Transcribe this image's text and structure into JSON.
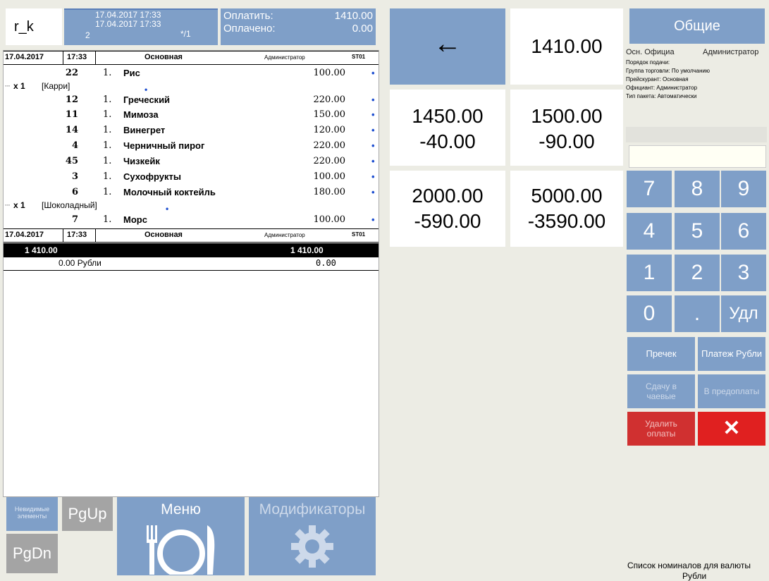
{
  "header": {
    "logo": "r_k",
    "date1": "17.04.2017 17:33",
    "date2": "17.04.2017 17:33",
    "guests": "2",
    "table": "*/1",
    "pay_label": "Оплатить:",
    "pay_value": "1410.00",
    "paid_label": "Оплачено:",
    "paid_value": "0.00"
  },
  "receipt": {
    "header_date": "17.04.2017",
    "header_time": "17:33",
    "header_menu": "Основная",
    "header_user": "Администратор",
    "header_station": "ST01",
    "items": [
      {
        "code": "22",
        "qty": "1.",
        "name": "Рис",
        "price": "100.00"
      },
      {
        "code": "12",
        "qty": "1.",
        "name": "Греческий",
        "price": "220.00"
      },
      {
        "code": "11",
        "qty": "1.",
        "name": "Мимоза",
        "price": "150.00"
      },
      {
        "code": "14",
        "qty": "1.",
        "name": "Винегрет",
        "price": "120.00"
      },
      {
        "code": "4",
        "qty": "1.",
        "name": "Черничный пирог",
        "price": "220.00"
      },
      {
        "code": "45",
        "qty": "1.",
        "name": "Чизкейк",
        "price": "220.00"
      },
      {
        "code": "3",
        "qty": "1.",
        "name": "Сухофрукты",
        "price": "100.00"
      },
      {
        "code": "6",
        "qty": "1.",
        "name": "Молочный коктейль",
        "price": "180.00"
      },
      {
        "code": "7",
        "qty": "1.",
        "name": "Морс",
        "price": "100.00"
      }
    ],
    "mod1_qty": "x 1",
    "mod1_name": "[Карри]",
    "mod2_qty": "x 1",
    "mod2_name": "[Шоколадный]",
    "footer_date": "17.04.2017",
    "footer_time": "17:33",
    "footer_menu": "Основная",
    "footer_user": "Администратор",
    "footer_station": "ST01",
    "total_left": "1 410.00",
    "total_right": "1 410.00",
    "currency_left": "0.00 Рубли",
    "currency_right": "0.00"
  },
  "bottom": {
    "invisible": "Невидимые элементы",
    "pgup": "PgUp",
    "pgdn": "PgDn",
    "menu": "Меню",
    "modifiers": "Модификаторы"
  },
  "payment": {
    "back": "←",
    "amount": "1410.00",
    "c1a": "1450.00",
    "c1b": "-40.00",
    "c2a": "1500.00",
    "c2b": "-90.00",
    "c3a": "2000.00",
    "c3b": "-590.00",
    "c4a": "5000.00",
    "c4b": "-3590.00"
  },
  "right": {
    "general": "Общие",
    "waiter_short": "Осн. Официа",
    "admin": "Администратор",
    "info1": "Порядок подачи:",
    "info2": "Группа торговли: По умолчанию",
    "info3": "Прейскурант: Основная",
    "info4": "Официант: Администратор",
    "info5": "Тип пакета: Автоматически",
    "keys": [
      "7",
      "8",
      "9",
      "4",
      "5",
      "6",
      "1",
      "2",
      "3",
      "0",
      ".",
      "Удл"
    ],
    "precheck": "Пречек",
    "pay_rub": "Платеж Рубли",
    "tips": "Сдачу в чаевые",
    "prepay": "В предоплаты",
    "delete": "Удалить оплаты",
    "close": "✕",
    "denom": "Список номиналов для валюты",
    "denom2": "Рубли"
  },
  "colors": {
    "accent": "#7f9fc8",
    "danger": "#d03030",
    "grey": "#a4a4a4"
  }
}
